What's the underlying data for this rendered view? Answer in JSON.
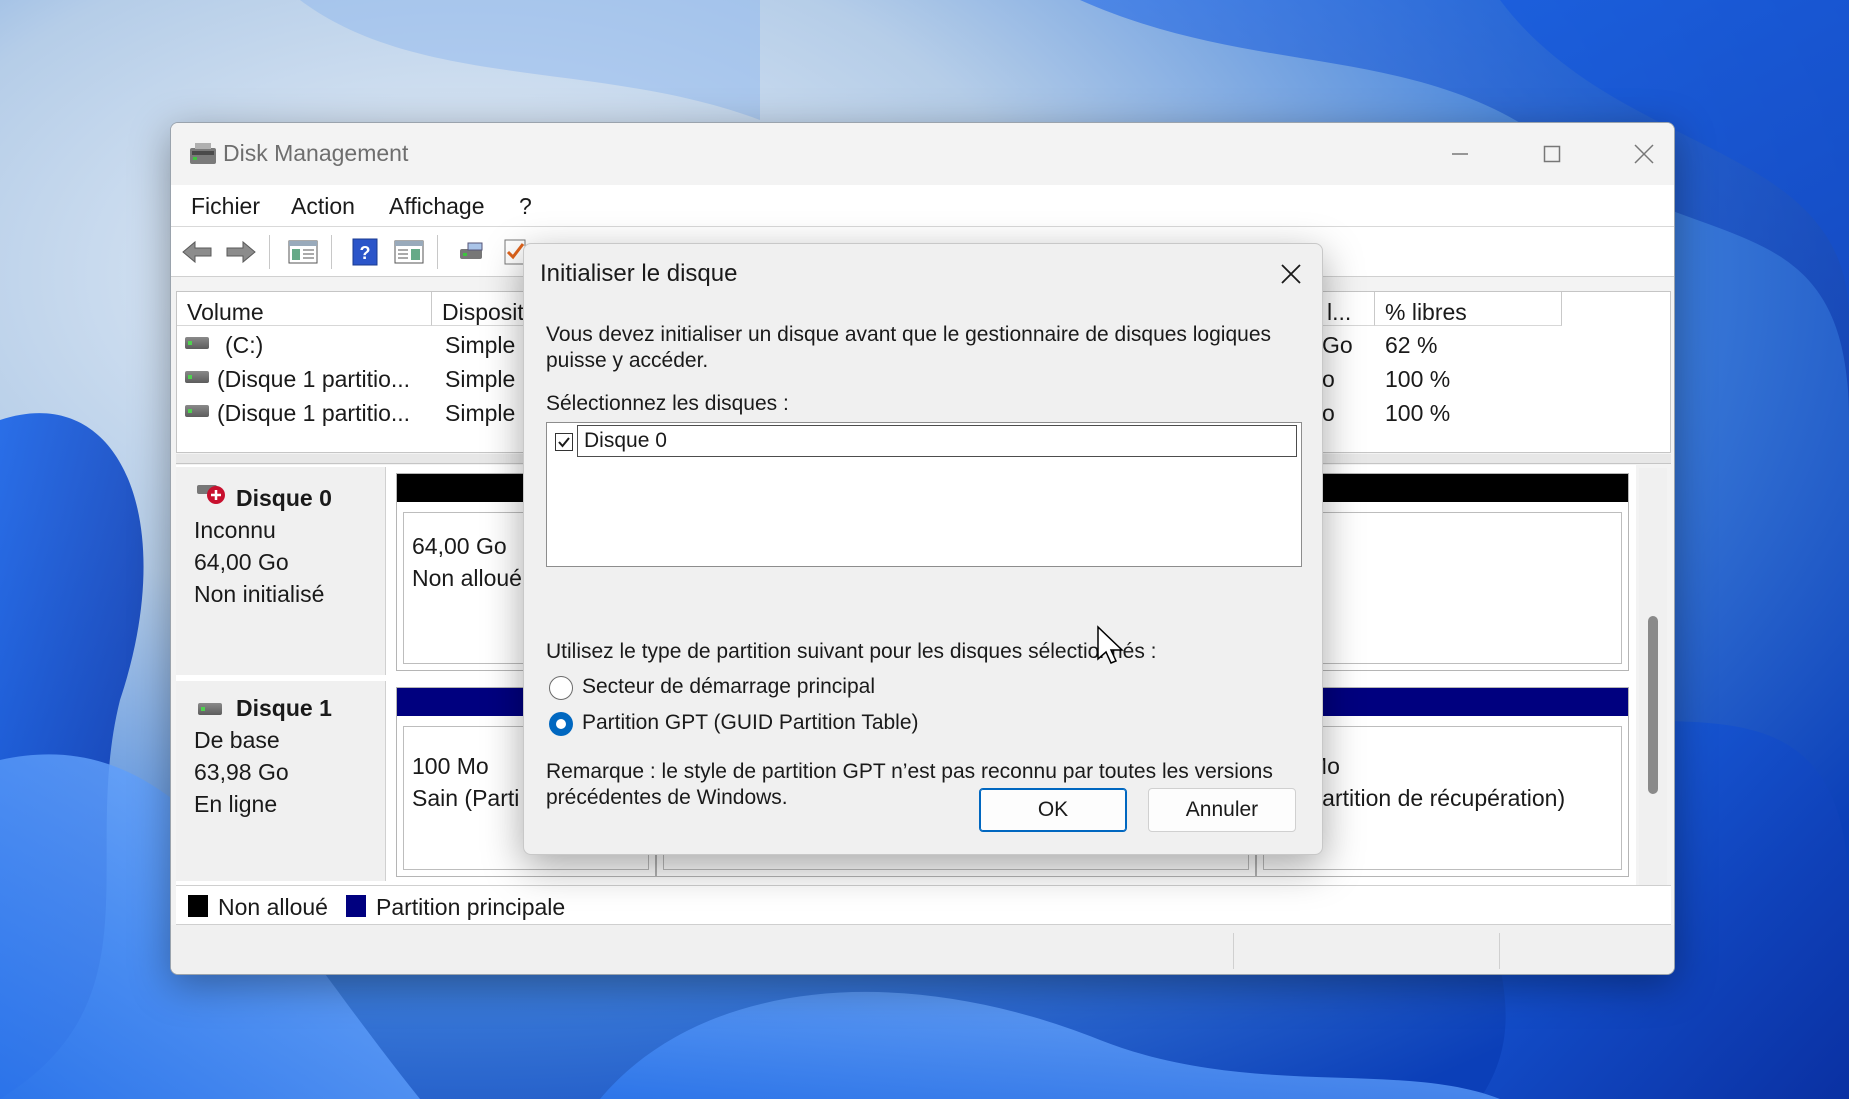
{
  "window": {
    "title": "Disk Management",
    "menu": [
      "Fichier",
      "Action",
      "Affichage",
      "?"
    ],
    "toolbar_icons": [
      "back-arrow-icon",
      "forward-arrow-icon",
      "console-tree-icon",
      "help-icon",
      "properties-icon",
      "connect-icon",
      "check-icon"
    ]
  },
  "volumes": {
    "headers": [
      "Volume",
      "Disposit",
      "l...",
      "% libres"
    ],
    "rows": [
      {
        "name": "(C:)",
        "layout": "Simple",
        "free": "Go",
        "pct": "62 %"
      },
      {
        "name": "(Disque 1 partitio...",
        "layout": "Simple",
        "free": "o",
        "pct": "100 %"
      },
      {
        "name": "(Disque 1 partitio...",
        "layout": "Simple",
        "free": "o",
        "pct": "100 %"
      }
    ]
  },
  "disks": [
    {
      "name": "Disque 0",
      "type": "Inconnu",
      "size": "64,00 Go",
      "status": "Non initialisé",
      "partitions": [
        {
          "size": "64,00 Go",
          "status": "Non alloué"
        }
      ]
    },
    {
      "name": "Disque 1",
      "type": "De base",
      "size": "63,98 Go",
      "status": "En ligne",
      "partitions": [
        {
          "size": "100 Mo",
          "status": "Sain (Parti"
        },
        {
          "size": "Mo",
          "status": "n (Partition de récupération)"
        }
      ]
    }
  ],
  "legend": [
    "Non alloué",
    "Partition principale"
  ],
  "colors": {
    "unallocated": "#000000",
    "primary": "#00007f",
    "accent": "#0067c0"
  },
  "dialog": {
    "title": "Initialiser le disque",
    "intro": "Vous devez initialiser un disque avant que le gestionnaire de disques logiques puisse y accéder.",
    "select_label": "Sélectionnez les disques :",
    "disk_item": "Disque 0",
    "disk_item_checked": true,
    "partition_label": "Utilisez le type de partition suivant pour les disques sélectionnés :",
    "option_mbr": "Secteur de démarrage principal",
    "option_gpt": "Partition GPT (GUID Partition Table)",
    "selected_option": "gpt",
    "note": "Remarque : le style de partition GPT n’est pas reconnu par toutes les versions précédentes de Windows.",
    "ok": "OK",
    "cancel": "Annuler"
  }
}
